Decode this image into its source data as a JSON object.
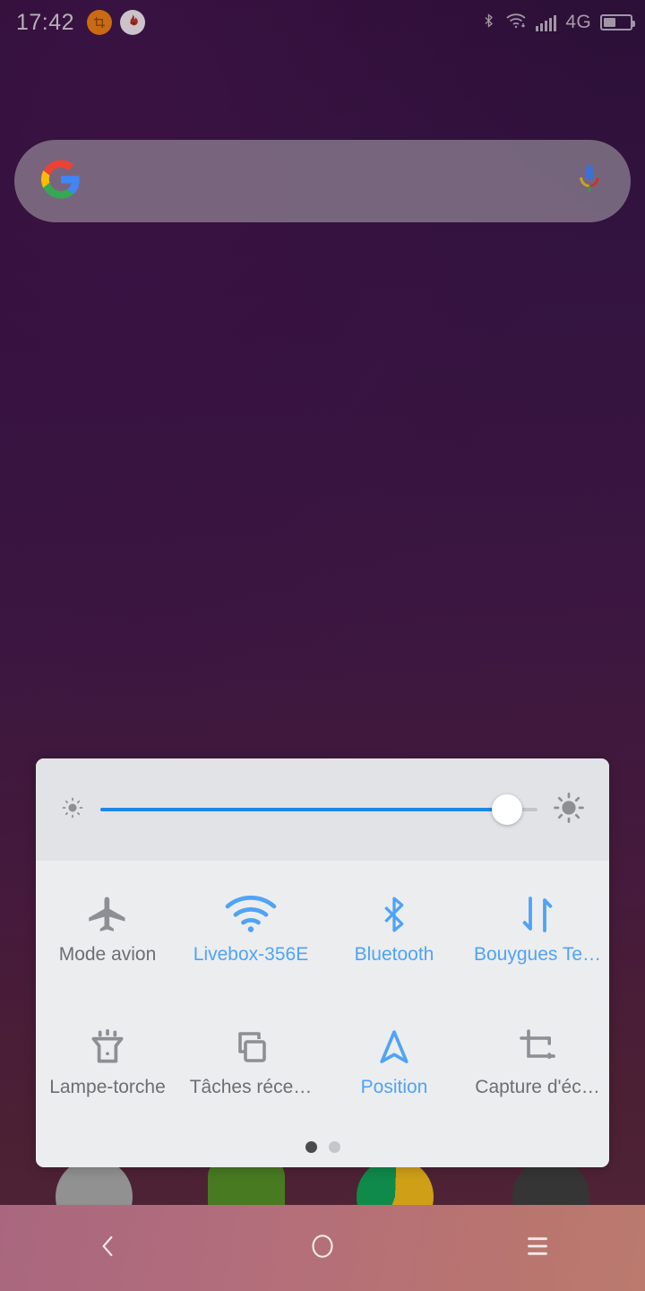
{
  "status_bar": {
    "clock": "17:42",
    "network_label": "4G",
    "battery_percent": 45,
    "notifications": [
      {
        "name": "screenshot-notification-icon",
        "glyph": "screenshot"
      },
      {
        "name": "flame-notification-icon",
        "glyph": "flame"
      }
    ],
    "icons": [
      "bluetooth-icon",
      "wifi-icon",
      "signal-icon",
      "battery-icon"
    ]
  },
  "search": {
    "placeholder": "",
    "value": "",
    "logo": "google-g-logo",
    "mic": "microphone-icon"
  },
  "quick_settings": {
    "brightness": {
      "label_low": "brightness-low-icon",
      "label_high": "brightness-high-icon",
      "value_percent": 93
    },
    "tiles": [
      {
        "label": "Mode avion",
        "icon": "airplane-icon",
        "state": "off"
      },
      {
        "label": "Livebox-356E",
        "icon": "wifi-icon",
        "state": "on"
      },
      {
        "label": "Bluetooth",
        "icon": "bluetooth-icon",
        "state": "on"
      },
      {
        "label": "Bouygues Te…",
        "icon": "mobile-data-icon",
        "state": "on"
      },
      {
        "label": "Lampe-torche",
        "icon": "flashlight-icon",
        "state": "off"
      },
      {
        "label": "Tâches réce…",
        "icon": "recent-tasks-icon",
        "state": "off"
      },
      {
        "label": "Position",
        "icon": "location-icon",
        "state": "on"
      },
      {
        "label": "Capture d'éc…",
        "icon": "screenshot-icon",
        "state": "off"
      }
    ],
    "pages": {
      "count": 2,
      "active_index": 0
    }
  },
  "nav_bar": {
    "buttons": [
      {
        "name": "back-button",
        "icon": "chevron-left-icon"
      },
      {
        "name": "home-button",
        "icon": "circle-icon"
      },
      {
        "name": "recents-button",
        "icon": "hamburger-icon"
      }
    ]
  },
  "colors": {
    "accent_blue": "#4fa3f7",
    "slider_blue": "#1e88e5",
    "panel_bg": "#ecedef",
    "brightness_bg": "#e2e3e7",
    "label_off": "#6d6e72",
    "wallpaper_top": "#2b0f36",
    "wallpaper_bottom": "#522636",
    "navbar_tint": "#b3707a"
  }
}
